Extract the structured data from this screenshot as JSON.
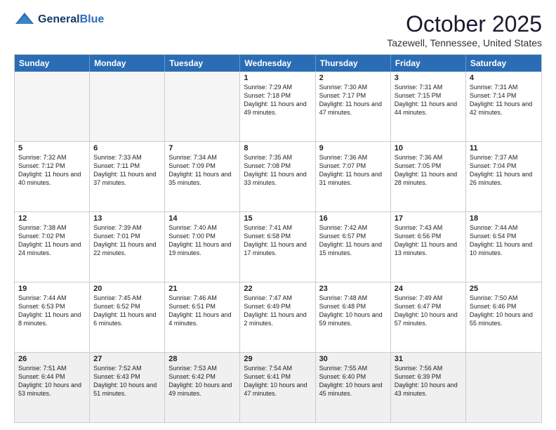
{
  "logo": {
    "line1": "General",
    "line2": "Blue"
  },
  "title": "October 2025",
  "location": "Tazewell, Tennessee, United States",
  "weekdays": [
    "Sunday",
    "Monday",
    "Tuesday",
    "Wednesday",
    "Thursday",
    "Friday",
    "Saturday"
  ],
  "rows": [
    [
      {
        "day": "",
        "text": "",
        "empty": true
      },
      {
        "day": "",
        "text": "",
        "empty": true
      },
      {
        "day": "",
        "text": "",
        "empty": true
      },
      {
        "day": "1",
        "text": "Sunrise: 7:29 AM\nSunset: 7:18 PM\nDaylight: 11 hours and 49 minutes."
      },
      {
        "day": "2",
        "text": "Sunrise: 7:30 AM\nSunset: 7:17 PM\nDaylight: 11 hours and 47 minutes."
      },
      {
        "day": "3",
        "text": "Sunrise: 7:31 AM\nSunset: 7:15 PM\nDaylight: 11 hours and 44 minutes."
      },
      {
        "day": "4",
        "text": "Sunrise: 7:31 AM\nSunset: 7:14 PM\nDaylight: 11 hours and 42 minutes."
      }
    ],
    [
      {
        "day": "5",
        "text": "Sunrise: 7:32 AM\nSunset: 7:12 PM\nDaylight: 11 hours and 40 minutes."
      },
      {
        "day": "6",
        "text": "Sunrise: 7:33 AM\nSunset: 7:11 PM\nDaylight: 11 hours and 37 minutes."
      },
      {
        "day": "7",
        "text": "Sunrise: 7:34 AM\nSunset: 7:09 PM\nDaylight: 11 hours and 35 minutes."
      },
      {
        "day": "8",
        "text": "Sunrise: 7:35 AM\nSunset: 7:08 PM\nDaylight: 11 hours and 33 minutes."
      },
      {
        "day": "9",
        "text": "Sunrise: 7:36 AM\nSunset: 7:07 PM\nDaylight: 11 hours and 31 minutes."
      },
      {
        "day": "10",
        "text": "Sunrise: 7:36 AM\nSunset: 7:05 PM\nDaylight: 11 hours and 28 minutes."
      },
      {
        "day": "11",
        "text": "Sunrise: 7:37 AM\nSunset: 7:04 PM\nDaylight: 11 hours and 26 minutes."
      }
    ],
    [
      {
        "day": "12",
        "text": "Sunrise: 7:38 AM\nSunset: 7:02 PM\nDaylight: 11 hours and 24 minutes."
      },
      {
        "day": "13",
        "text": "Sunrise: 7:39 AM\nSunset: 7:01 PM\nDaylight: 11 hours and 22 minutes."
      },
      {
        "day": "14",
        "text": "Sunrise: 7:40 AM\nSunset: 7:00 PM\nDaylight: 11 hours and 19 minutes."
      },
      {
        "day": "15",
        "text": "Sunrise: 7:41 AM\nSunset: 6:58 PM\nDaylight: 11 hours and 17 minutes."
      },
      {
        "day": "16",
        "text": "Sunrise: 7:42 AM\nSunset: 6:57 PM\nDaylight: 11 hours and 15 minutes."
      },
      {
        "day": "17",
        "text": "Sunrise: 7:43 AM\nSunset: 6:56 PM\nDaylight: 11 hours and 13 minutes."
      },
      {
        "day": "18",
        "text": "Sunrise: 7:44 AM\nSunset: 6:54 PM\nDaylight: 11 hours and 10 minutes."
      }
    ],
    [
      {
        "day": "19",
        "text": "Sunrise: 7:44 AM\nSunset: 6:53 PM\nDaylight: 11 hours and 8 minutes."
      },
      {
        "day": "20",
        "text": "Sunrise: 7:45 AM\nSunset: 6:52 PM\nDaylight: 11 hours and 6 minutes."
      },
      {
        "day": "21",
        "text": "Sunrise: 7:46 AM\nSunset: 6:51 PM\nDaylight: 11 hours and 4 minutes."
      },
      {
        "day": "22",
        "text": "Sunrise: 7:47 AM\nSunset: 6:49 PM\nDaylight: 11 hours and 2 minutes."
      },
      {
        "day": "23",
        "text": "Sunrise: 7:48 AM\nSunset: 6:48 PM\nDaylight: 10 hours and 59 minutes."
      },
      {
        "day": "24",
        "text": "Sunrise: 7:49 AM\nSunset: 6:47 PM\nDaylight: 10 hours and 57 minutes."
      },
      {
        "day": "25",
        "text": "Sunrise: 7:50 AM\nSunset: 6:46 PM\nDaylight: 10 hours and 55 minutes."
      }
    ],
    [
      {
        "day": "26",
        "text": "Sunrise: 7:51 AM\nSunset: 6:44 PM\nDaylight: 10 hours and 53 minutes."
      },
      {
        "day": "27",
        "text": "Sunrise: 7:52 AM\nSunset: 6:43 PM\nDaylight: 10 hours and 51 minutes."
      },
      {
        "day": "28",
        "text": "Sunrise: 7:53 AM\nSunset: 6:42 PM\nDaylight: 10 hours and 49 minutes."
      },
      {
        "day": "29",
        "text": "Sunrise: 7:54 AM\nSunset: 6:41 PM\nDaylight: 10 hours and 47 minutes."
      },
      {
        "day": "30",
        "text": "Sunrise: 7:55 AM\nSunset: 6:40 PM\nDaylight: 10 hours and 45 minutes."
      },
      {
        "day": "31",
        "text": "Sunrise: 7:56 AM\nSunset: 6:39 PM\nDaylight: 10 hours and 43 minutes."
      },
      {
        "day": "",
        "text": "",
        "empty": true
      }
    ]
  ]
}
